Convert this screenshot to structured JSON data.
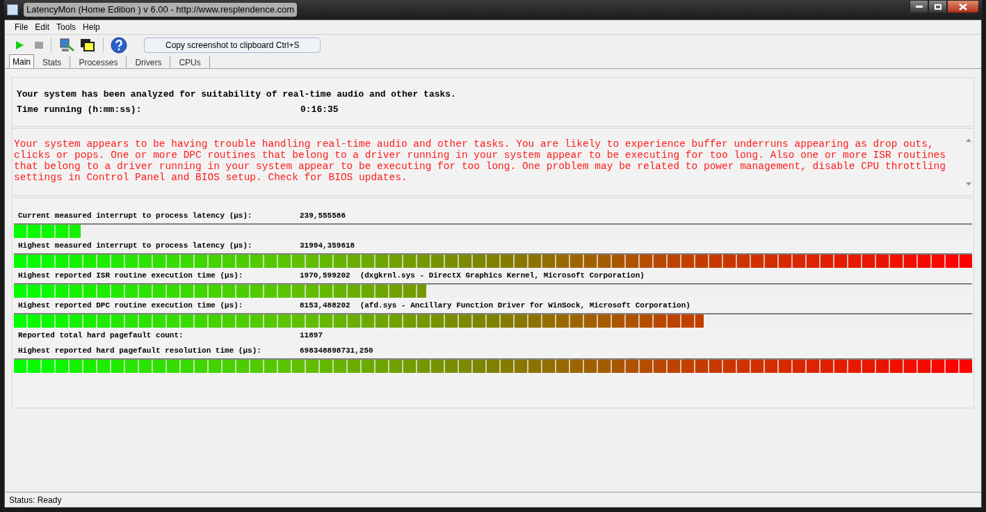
{
  "window": {
    "title": "LatencyMon  (Home Edition )  v 6.00 - http://www.resplendence.com"
  },
  "menu": [
    "File",
    "Edit",
    "Tools",
    "Help"
  ],
  "toolbar": {
    "tooltip": "Copy screenshot to clipboard Ctrl+S"
  },
  "tabs": [
    {
      "label": "Main",
      "selected": true
    },
    {
      "label": "Stats",
      "selected": false
    },
    {
      "label": "Processes",
      "selected": false
    },
    {
      "label": "Drivers",
      "selected": false
    },
    {
      "label": "CPUs",
      "selected": false
    }
  ],
  "summary": {
    "message": "Your system has been analyzed for suitability of real-time audio and other tasks.",
    "time_label": "Time running (h:mm:ss):",
    "time_value": "0:16:35"
  },
  "verdict": "Your system appears to be having trouble handling real-time audio and other tasks. You are likely to experience buffer underruns appearing as drop outs, clicks or pops. One or more DPC routines that belong to a driver running in your system appear to be executing for too long. Also one or more ISR routines that belong to a driver running in your system appear to be executing for too long. One problem may be related to power management, disable CPU throttling settings in Control Panel and BIOS setup. Check for BIOS updates.",
  "metrics": [
    {
      "label": "Current measured interrupt to process latency (µs):",
      "value": "239,555586",
      "level": 0.07
    },
    {
      "label": "Highest measured interrupt to process latency (µs):",
      "value": "31994,359618",
      "level": 1.0
    },
    {
      "label": "Highest reported ISR routine execution time (µs):",
      "value": "1970,599202",
      "detail": "(dxgkrnl.sys - DirectX Graphics Kernel, Microsoft Corporation)",
      "level": 0.43
    },
    {
      "label": "Highest reported DPC routine execution time (µs):",
      "value": "8153,488202",
      "detail": "(afd.sys - Ancillary Function Driver for WinSock, Microsoft Corporation)",
      "level": 0.72
    },
    {
      "label": "Reported total hard pagefault count:",
      "value": "11897"
    },
    {
      "label": "Highest reported hard pagefault resolution time (µs):",
      "value": "698348898731,250",
      "level": 1.0
    }
  ],
  "status_bar": "Status: Ready"
}
